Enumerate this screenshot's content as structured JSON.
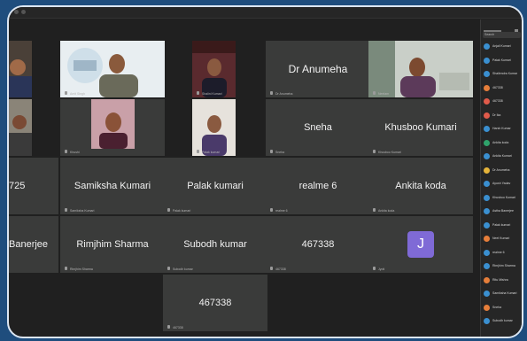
{
  "colors": {
    "background": "#1f4d7d",
    "tile": "#3a3b3a",
    "avatar_j": "#7f6ad6"
  },
  "tiles": {
    "t1": {
      "tag": ""
    },
    "t2": {
      "tag": "Amit Singh"
    },
    "t3": {
      "tag": "Shalini Kumari"
    },
    "t4": {
      "tag": "Dr Anumeha",
      "name": "Dr Anumeha"
    },
    "t5": {
      "tag": "Neelam"
    },
    "t6": {
      "tag": ""
    },
    "t7": {
      "tag": "Khushi"
    },
    "t8": {
      "tag": "Palak kumari"
    },
    "t9": {
      "name": "Sneha",
      "tag": "Sneha"
    },
    "t10": {
      "name": "Khusboo Kumari",
      "tag": "Khusboo Kumari"
    },
    "t11": {
      "name": "725",
      "tag": ""
    },
    "t12": {
      "name": "Samiksha Kumari",
      "tag": "Samiksha Kumari"
    },
    "t13": {
      "name": "Palak kumari",
      "tag": "Palak kumari"
    },
    "t14": {
      "name": "realme 6",
      "tag": "realme 6"
    },
    "t15": {
      "name": "Ankita koda",
      "tag": "Ankita koda"
    },
    "t16": {
      "name": "Banerjee",
      "tag": ""
    },
    "t17": {
      "name": "Rimjhim Sharma",
      "tag": "Rimjhim Sharma"
    },
    "t18": {
      "name": "Subodh kumar",
      "tag": "Subodh kumar"
    },
    "t19": {
      "name": "467338",
      "tag": "467338"
    },
    "t20": {
      "initial": "J",
      "tag": "Jyoti"
    },
    "t21": {
      "name": "467338",
      "tag": "467338"
    }
  },
  "sidebar": {
    "title": "Participants",
    "search_placeholder": "Search",
    "participants": [
      {
        "name": "Anjali Kumari",
        "color": "#3a8fd0"
      },
      {
        "name": "Palak Kumari",
        "color": "#3a8fd0"
      },
      {
        "name": "Shailendra Kumar",
        "color": "#3a8fd0"
      },
      {
        "name": "467338",
        "color": "#e67e3a"
      },
      {
        "name": "467338",
        "color": "#e05a4a"
      },
      {
        "name": "Dr Ika",
        "color": "#e05a4a"
      },
      {
        "name": "Harsh Kumar",
        "color": "#3a8fd0"
      },
      {
        "name": "Ankita koda",
        "color": "#2fa36b"
      },
      {
        "name": "Ankita Kumari",
        "color": "#3a8fd0"
      },
      {
        "name": "Dr Anumeha",
        "color": "#e6b43a"
      },
      {
        "name": "Ayush Yadav",
        "color": "#3a8fd0"
      },
      {
        "name": "Khusboo Kumari",
        "color": "#3a8fd0"
      },
      {
        "name": "Astha Banerjee",
        "color": "#3a8fd0"
      },
      {
        "name": "Palak kumari",
        "color": "#3a8fd0"
      },
      {
        "name": "Neel Kumari",
        "color": "#e67e3a"
      },
      {
        "name": "realme 6",
        "color": "#3a8fd0"
      },
      {
        "name": "Rimjhim Sharma",
        "color": "#3a8fd0"
      },
      {
        "name": "Ritu Mishra",
        "color": "#e67e3a"
      },
      {
        "name": "Samiksha Kumari",
        "color": "#3a8fd0"
      },
      {
        "name": "Sneha",
        "color": "#e67e3a"
      },
      {
        "name": "Subodh kumar",
        "color": "#3a8fd0"
      }
    ]
  }
}
